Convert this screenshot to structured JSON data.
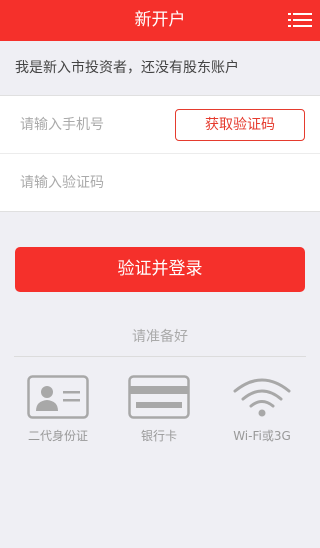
{
  "header": {
    "title": "新开户",
    "menu_icon": "menu-icon"
  },
  "notice": {
    "text": "我是新入市投资者，还没有股东账户"
  },
  "form": {
    "phone_placeholder": "请输入手机号",
    "code_button": "获取验证码",
    "code_placeholder": "请输入验证码"
  },
  "login_button": "验证并登录",
  "prepare": {
    "title": "请准备好",
    "items": [
      {
        "label": "二代身份证",
        "icon": "id-card-icon"
      },
      {
        "label": "银行卡",
        "icon": "bank-card-icon"
      },
      {
        "label": "Wi-Fi或3G",
        "icon": "wifi-icon"
      }
    ]
  },
  "colors": {
    "accent": "#f5302b",
    "background": "#efeff4",
    "muted": "#999999"
  }
}
